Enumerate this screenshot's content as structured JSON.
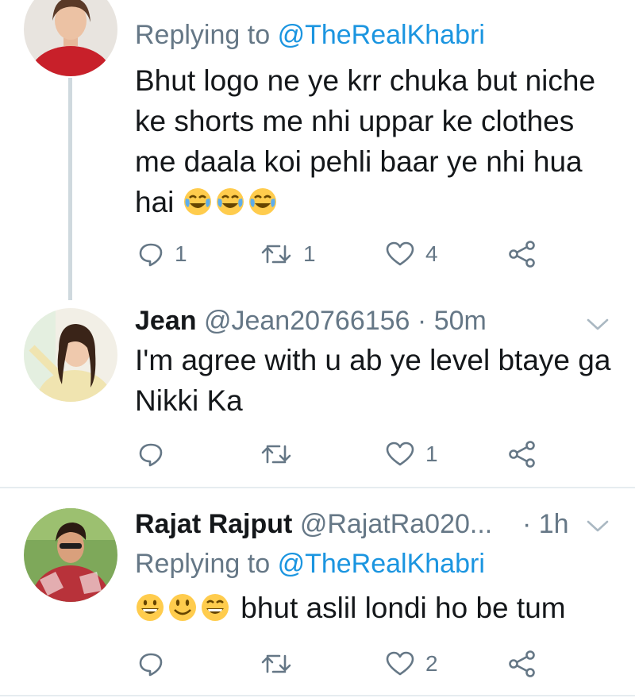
{
  "tweets": [
    {
      "replying_prefix": "Replying to",
      "replying_mention": "@TheRealKhabri",
      "text": "Bhut logo ne ye krr chuka but niche ke shorts me nhi uppar ke clothes me daala koi pehli baar ye nhi hua hai",
      "emojis": [
        "tears-of-joy-emoji",
        "tears-of-joy-emoji",
        "tears-of-joy-emoji"
      ],
      "reply_count": "1",
      "retweet_count": "1",
      "like_count": "4"
    },
    {
      "name": "Jean",
      "handle": "@Jean20766156",
      "time": "· 50m",
      "text": "I'm agree  with u ab ye level btaye ga Nikki Ka",
      "reply_count": "",
      "retweet_count": "",
      "like_count": "1"
    },
    {
      "name": "Rajat Rajput",
      "handle": "@RajatRa020...",
      "time": "· 1h",
      "replying_prefix": "Replying to",
      "replying_mention": "@TheRealKhabri",
      "emojis": [
        "grinning-face-emoji",
        "smiling-face-emoji",
        "grinning-squinting-emoji"
      ],
      "text": "bhut aslil londi ho be tum",
      "reply_count": "",
      "retweet_count": "",
      "like_count": "2"
    }
  ],
  "colors": {
    "text": "#14171a",
    "secondary": "#657786",
    "link": "#1b95e0",
    "divider": "#e6ecf0",
    "thread_line": "#cfd9de"
  }
}
